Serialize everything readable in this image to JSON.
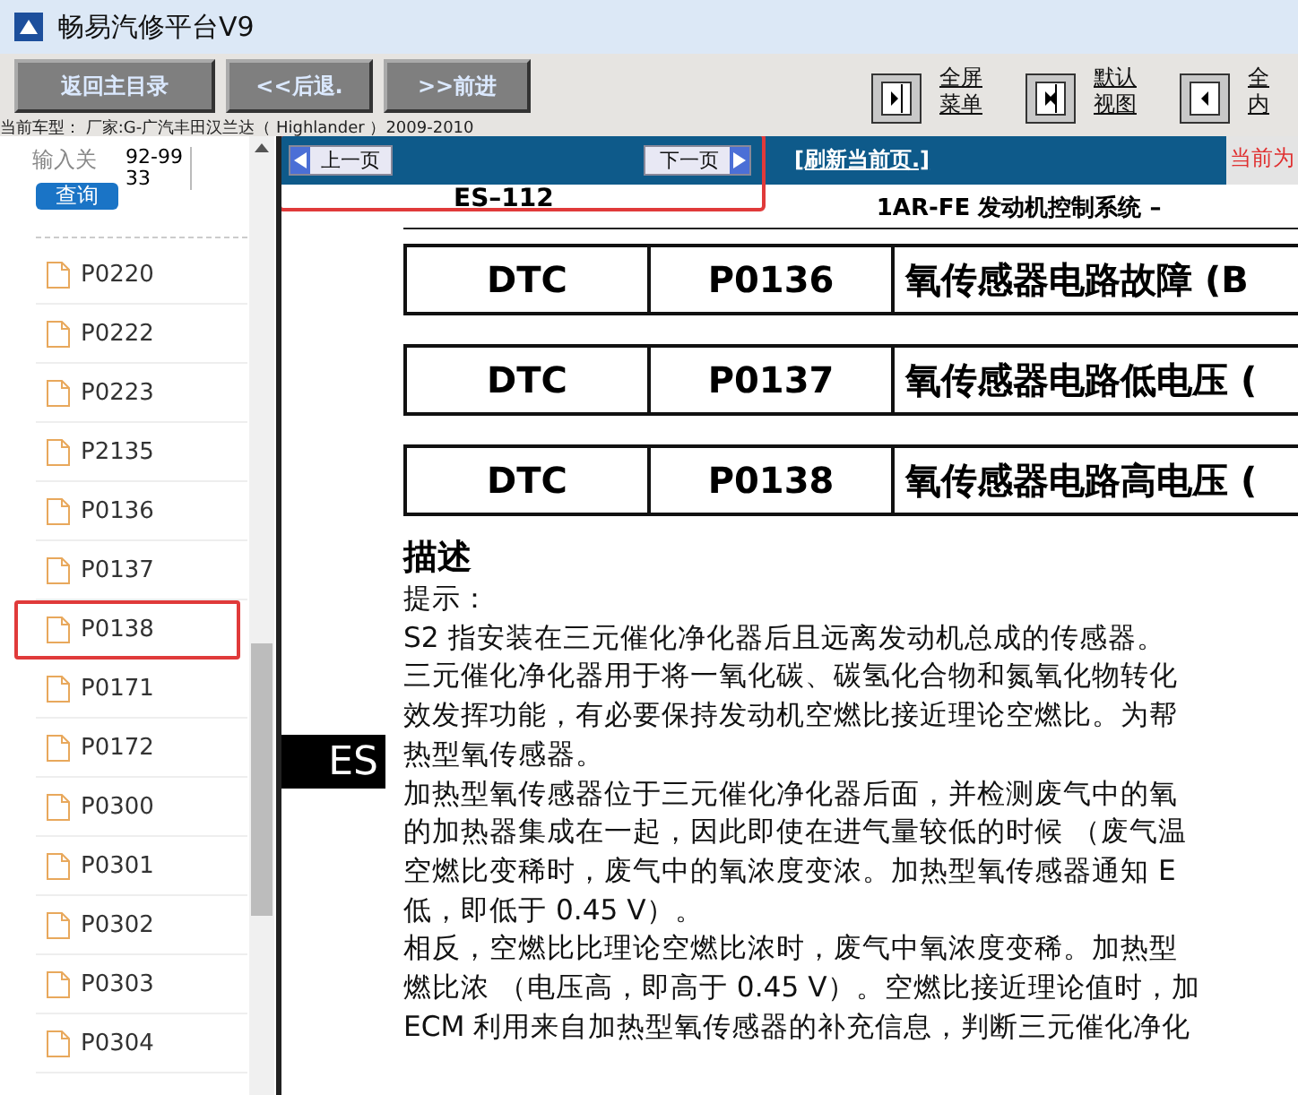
{
  "window": {
    "title": "畅易汽修平台V9"
  },
  "toolbar": {
    "buttons": [
      "返回主目录",
      "<<后退.",
      ">>前进"
    ],
    "view_buttons": [
      {
        "kind": "right",
        "label": [
          "全屏",
          "菜单"
        ]
      },
      {
        "kind": "both",
        "label": [
          "默认",
          "视图"
        ]
      },
      {
        "kind": "left",
        "label": [
          "全",
          "内"
        ]
      }
    ]
  },
  "vehicle": "当前车型： 厂家:G-广汽丰田汉兰达（ Highlander ）2009-2010",
  "sidebar": {
    "search": {
      "placeholder": "输入关",
      "value": "92-9933",
      "button": "查询"
    },
    "items": [
      {
        "label": "P0220",
        "selected": false
      },
      {
        "label": "P0222",
        "selected": false
      },
      {
        "label": "P0223",
        "selected": false
      },
      {
        "label": "P2135",
        "selected": false
      },
      {
        "label": "P0136",
        "selected": false
      },
      {
        "label": "P0137",
        "selected": false
      },
      {
        "label": "P0138",
        "selected": true
      },
      {
        "label": "P0171",
        "selected": false
      },
      {
        "label": "P0172",
        "selected": false
      },
      {
        "label": "P0300",
        "selected": false
      },
      {
        "label": "P0301",
        "selected": false
      },
      {
        "label": "P0302",
        "selected": false
      },
      {
        "label": "P0303",
        "selected": false
      },
      {
        "label": "P0304",
        "selected": false
      }
    ]
  },
  "navbar": {
    "prev": "上一页",
    "next": "下一页",
    "refresh": "[刷新当前页.]",
    "current": "当前为"
  },
  "document": {
    "page": "ES–112",
    "section": "1AR-FE 发动机控制系统 –",
    "side_tab": "ES",
    "dtc_rows": [
      {
        "label": "DTC",
        "code": "P0136",
        "title": "氧传感器电路故障 (B"
      },
      {
        "label": "DTC",
        "code": "P0137",
        "title": "氧传感器电路低电压 ("
      },
      {
        "label": "DTC",
        "code": "P0138",
        "title": "氧传感器电路高电压 ("
      }
    ],
    "heading": "描述",
    "hint": "提示：",
    "lines": [
      "S2 指安装在三元催化净化器后且远离发动机总成的传感器。",
      "三元催化净化器用于将一氧化碳、碳氢化合物和氮氧化物转化",
      "效发挥功能，有必要保持发动机空燃比接近理论空燃比。为帮",
      "热型氧传感器。",
      "加热型氧传感器位于三元催化净化器后面，并检测废气中的氧",
      "的加热器集成在一起，因此即使在进气量较低的时候 （废气温",
      "空燃比变稀时，废气中的氧浓度变浓。加热型氧传感器通知 E",
      "低，即低于 0.45 V）。",
      "相反，空燃比比理论空燃比浓时，废气中氧浓度变稀。加热型",
      "燃比浓 （电压高，即高于 0.45 V）。空燃比接近理论值时，加",
      "ECM 利用来自加热型氧传感器的补充信息，判断三元催化净化"
    ]
  }
}
